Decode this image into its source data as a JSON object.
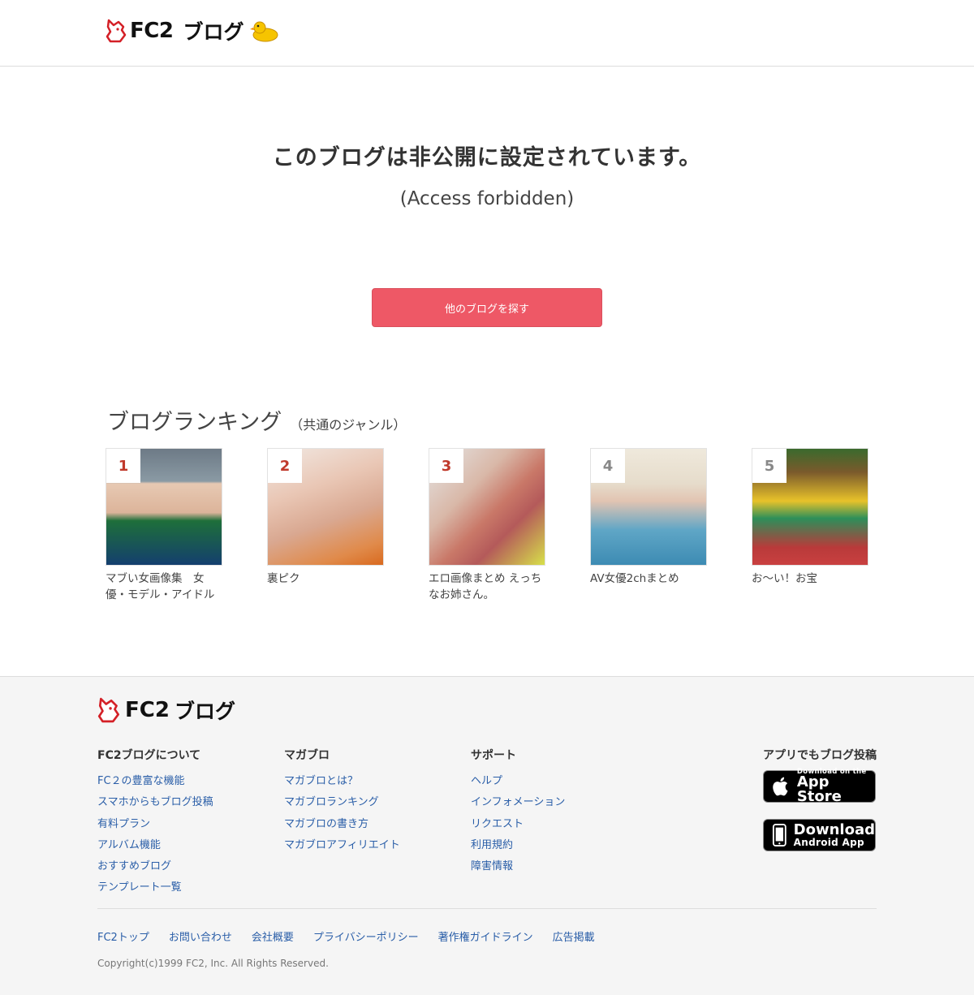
{
  "header": {
    "logo_fc2": "FC2",
    "logo_blog": "ブログ"
  },
  "main": {
    "title": "このブログは非公開に設定されています。",
    "subtitle": "(Access forbidden)",
    "cta_label": "他のブログを探す"
  },
  "ranking": {
    "title": "ブログランキング",
    "subtitle": "（共通のジャンル）",
    "items": [
      {
        "rank": "1",
        "name": "マブい女画像集　女優・モデル・アイドル"
      },
      {
        "rank": "2",
        "name": "裏ピク"
      },
      {
        "rank": "3",
        "name": "エロ画像まとめ えっちなお姉さん。"
      },
      {
        "rank": "4",
        "name": "AV女優2chまとめ"
      },
      {
        "rank": "5",
        "name": "お〜い！お宝"
      }
    ]
  },
  "footer": {
    "logo_fc2": "FC2",
    "logo_blog": "ブログ",
    "columns": [
      {
        "heading": "FC2ブログについて",
        "links": [
          "FC２の豊富な機能",
          "スマホからもブログ投稿",
          "有料プラン",
          "アルバム機能",
          "おすすめブログ",
          "テンプレート一覧"
        ]
      },
      {
        "heading": "マガブロ",
        "links": [
          "マガブロとは？",
          "マガブロランキング",
          "マガブロの書き方",
          "マガブロアフィリエイト"
        ]
      },
      {
        "heading": "サポート",
        "links": [
          "ヘルプ",
          "インフォメーション",
          "リクエスト",
          "利用規約",
          "障害情報"
        ]
      }
    ],
    "apps": {
      "heading": "アプリでもブログ投稿",
      "appstore_small": "Download on the",
      "appstore_big": "App Store",
      "android_big": "Download",
      "android_small": "Android App"
    },
    "bottom_links": [
      "FC2トップ",
      "お問い合わせ",
      "会社概要",
      "プライバシーポリシー",
      "著作権ガイドライン",
      "広告掲載"
    ],
    "copyright": "Copyright(c)1999 FC2, Inc. All Rights Reserved."
  },
  "colors": {
    "accent": "#ee5866",
    "link": "#2a5ea8",
    "rank_top": "#c0392b"
  }
}
